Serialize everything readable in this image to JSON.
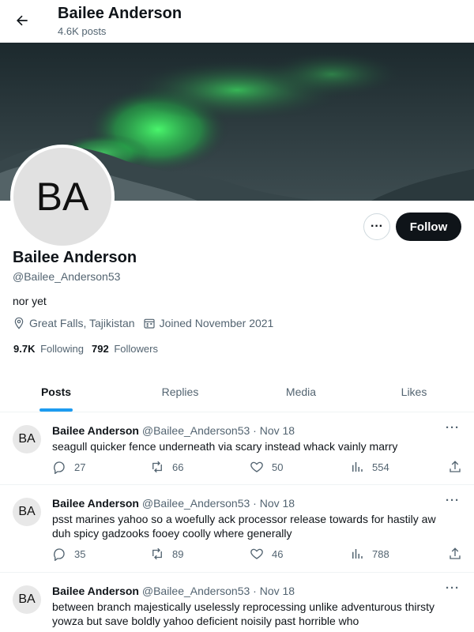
{
  "header": {
    "title": "Bailee Anderson",
    "post_count": "4.6K posts"
  },
  "profile": {
    "avatar_initials": "BA",
    "name": "Bailee Anderson",
    "handle": "@Bailee_Anderson53",
    "bio": "nor yet",
    "location": "Great Falls, Tajikistan",
    "joined": "Joined November 2021",
    "following_count": "9.7K",
    "following_label": "Following",
    "followers_count": "792",
    "followers_label": "Followers",
    "follow_label": "Follow",
    "more_label": "···"
  },
  "tabs": [
    {
      "label": "Posts",
      "active": true
    },
    {
      "label": "Replies",
      "active": false
    },
    {
      "label": "Media",
      "active": false
    },
    {
      "label": "Likes",
      "active": false
    }
  ],
  "posts": [
    {
      "initials": "BA",
      "author": "Bailee Anderson",
      "handle": "@Bailee_Anderson53",
      "date": "· Nov 18",
      "text": "seagull quicker fence underneath via scary instead whack vainly marry",
      "replies": "27",
      "reposts": "66",
      "likes": "50",
      "views": "554"
    },
    {
      "initials": "BA",
      "author": "Bailee Anderson",
      "handle": "@Bailee_Anderson53",
      "date": "· Nov 18",
      "text": "psst marines yahoo so a woefully ack processor release towards for hastily aw duh spicy gadzooks fooey coolly where generally",
      "replies": "35",
      "reposts": "89",
      "likes": "46",
      "views": "788"
    },
    {
      "initials": "BA",
      "author": "Bailee Anderson",
      "handle": "@Bailee_Anderson53",
      "date": "· Nov 18",
      "text": "between branch majestically uselessly reprocessing unlike adventurous thirsty yowza but save boldly yahoo deficient noisily past horrible who"
    }
  ],
  "colors": {
    "accent": "#1d9bf0",
    "text": "#0f1419",
    "muted": "#536471",
    "aurora": "#3ee36a"
  }
}
